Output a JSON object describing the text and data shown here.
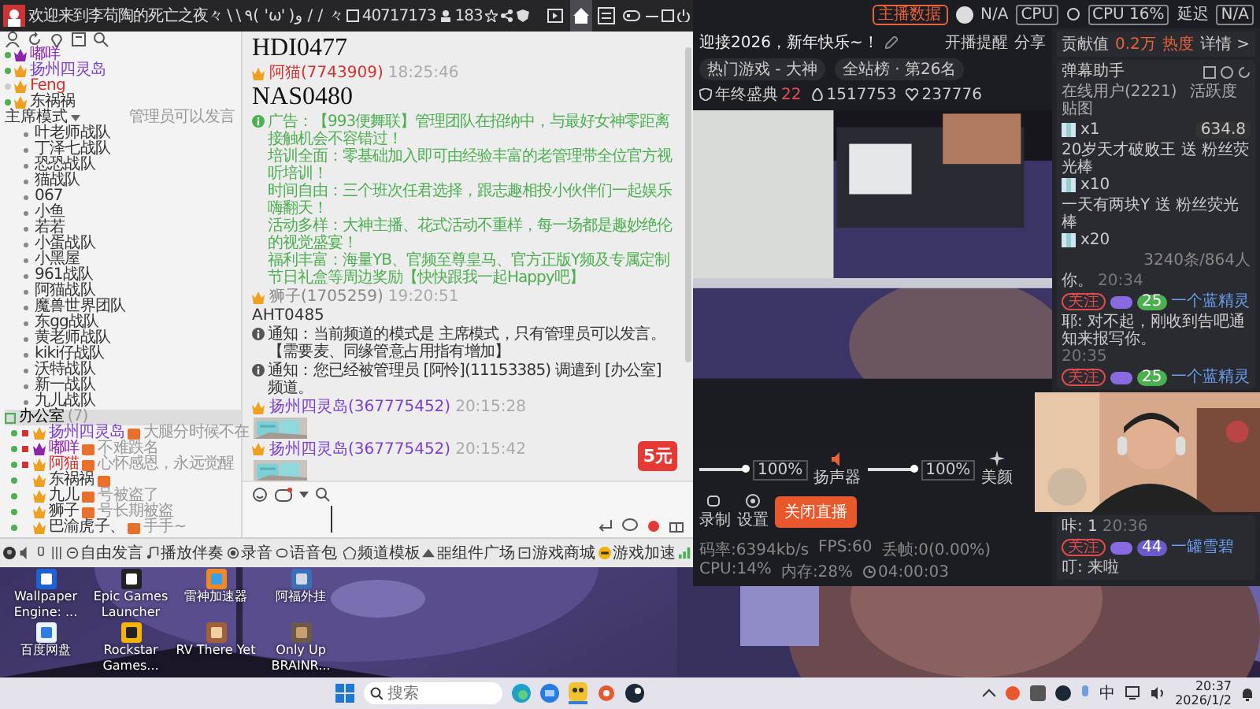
{
  "chat_window": {
    "title": "欢迎来到李苟陶的死亡之夜々 \\ \\ ٩( 'ω' )و / / 々",
    "channel_id": "40717173",
    "online_count": "183",
    "nav": [
      {
        "kind": "video",
        "selected": false
      },
      {
        "kind": "home",
        "selected": true
      },
      {
        "kind": "board",
        "selected": false
      },
      {
        "kind": "gamepad",
        "selected": false
      }
    ],
    "top_members": [
      {
        "name": "嘟咩",
        "color": "#8e24aa",
        "online": true
      },
      {
        "name": "扬州四灵岛",
        "color": "#7b3fd1",
        "online": true
      },
      {
        "name": "Feng",
        "color": "#d32f2f",
        "online": false
      },
      {
        "name": "东祸祸",
        "color": "#333333",
        "online": true
      }
    ],
    "mode": "主席模式",
    "mode_note": "管理员可以发言",
    "channels": [
      "叶老师战队",
      "丁泽七战队",
      "恐恐战队",
      "猫战队",
      "067",
      "小鱼",
      "若若",
      "小蛋战队",
      "小黑屋",
      "961战队",
      "阿猫战队",
      "魔兽世界团队",
      "东gg战队",
      "黄老师战队",
      "kiki仔战队",
      "沃特战队",
      "新一战队",
      "九儿战队"
    ],
    "office": {
      "name": "办公室",
      "count": "(7)"
    },
    "office_members": [
      {
        "name": "扬州四灵岛",
        "color": "#7b3fd1",
        "tagged": true,
        "status": "大腿分时候不在"
      },
      {
        "name": "嘟咩",
        "color": "#8e24aa",
        "tagged": true,
        "status": "不难跌名"
      },
      {
        "name": "阿猫",
        "color": "#d32f2f",
        "tagged": true,
        "status": "心怀感恩，永远觉醒"
      },
      {
        "name": "东祸祸",
        "color": "#333333",
        "tagged": false
      },
      {
        "name": "九儿",
        "color": "#333333",
        "tagged": false,
        "status": "号被盗了"
      },
      {
        "name": "狮子",
        "color": "#333333",
        "tagged": false,
        "status": "号长期被盗"
      },
      {
        "name": "巴渝虎子、",
        "color": "#333333",
        "tagged": false,
        "status": "手手~"
      }
    ],
    "messages": [
      {
        "kind": "code",
        "text": "HDI0477"
      },
      {
        "kind": "sender",
        "name": "阿猫(7743909)",
        "color": "#d32f2f",
        "time": "18:25:46"
      },
      {
        "kind": "code",
        "text": "NAS0480"
      },
      {
        "kind": "ad",
        "lines": [
          "广告：【993便舞联】管理团队在招纳中，与最好女神零距离接触机会不容错过！",
          "培训全面：零基础加入即可由经验丰富的老管理带全位官方视听培训！",
          "时间自由：三个班次任君选择，跟志趣相投小伙伴们一起娱乐嗨翻天！",
          "活动多样：大神主播、花式活动不重样，每一场都是趣妙绝伦的视觉盛宴！",
          "福利丰富：海量YB、官频至尊皇马、官方正版Y频及专属定制节日礼盒等周边奖励【快快跟我一起Happy吧】"
        ]
      },
      {
        "kind": "sender",
        "name": "狮子(1705259)",
        "color": "#888888",
        "time": "19:20:51"
      },
      {
        "kind": "text",
        "text": "AHT0485"
      },
      {
        "kind": "notice",
        "text": "通知：当前频道的模式是 主席模式，只有管理员可以发言。【需要麦、同缘管意占用指有增加】"
      },
      {
        "kind": "notice",
        "text": "通知：您已经被管理员 [阿怜](11153385) 调遣到 [办公室] 频道。"
      },
      {
        "kind": "sender",
        "name": "扬州四灵岛(367775452)",
        "color": "#7b3fd1",
        "time": "20:15:28"
      },
      {
        "kind": "picture"
      },
      {
        "kind": "sender",
        "name": "扬州四灵岛(367775452)",
        "color": "#7b3fd1",
        "time": "20:15:42"
      },
      {
        "kind": "picture"
      }
    ],
    "red_packet": "5元",
    "toolbar": [
      {
        "kind": "mic",
        "label": "自由发言"
      },
      {
        "kind": "music",
        "label": "播放伴奏"
      },
      {
        "kind": "record",
        "label": "录音"
      },
      {
        "kind": "voice",
        "label": "语音包"
      },
      {
        "kind": "template",
        "label": "频道模板"
      },
      {
        "kind": "widgets",
        "label": "组件广场"
      },
      {
        "kind": "shop",
        "label": "游戏商城"
      },
      {
        "kind": "boost",
        "label": "游戏加速"
      }
    ]
  },
  "stream_app": {
    "data_button": "主播数据",
    "avatar_text": "N/A",
    "gpu_label": "CPU",
    "cpu_label": "CPU 16%",
    "latency_label": "延迟",
    "latency_value": "N/A",
    "title": "迎接2026，新年快乐~！",
    "remind": "开播提醒",
    "share": "分享",
    "category": "热门游戏 - 大神",
    "rank": "全站榜 · 第26名",
    "event": "年终盛典",
    "event_value": "22",
    "views": "1517753",
    "likes": "237776",
    "mic": {
      "level": 1,
      "reading": "100%"
    },
    "speaker": {
      "label": "扬声器",
      "level": 1,
      "reading": "100%"
    },
    "tools": [
      {
        "kind": "beauty",
        "label": "美颜"
      },
      {
        "kind": "record",
        "label": "录制"
      },
      {
        "kind": "settings",
        "label": "设置"
      }
    ],
    "live_button": "关闭直播",
    "stats": [
      "码率:6394kb/s",
      "FPS:60",
      "丢帧:0(0.00%)",
      "CPU:14%",
      "内存:28%",
      "04:00:03"
    ],
    "panel": {
      "contribution_label": "贡献值",
      "contribution_value": "0.2万",
      "heat": "热度",
      "details": "详情 >",
      "title": "弹幕助手",
      "tabs": [
        "在线用户(2221)",
        "活跃度",
        "贴图"
      ],
      "feed": [
        {
          "kind": "gift",
          "text": "x1",
          "amount": "634.8"
        },
        {
          "kind": "line",
          "text": "20岁天才破败王 送 粉丝荧光棒",
          "suffix": "x10"
        },
        {
          "kind": "line",
          "text": "一天有两块Y 送 粉丝荧光棒",
          "suffix": "x20"
        },
        {
          "kind": "count",
          "text": "3240条/864人"
        },
        {
          "kind": "line",
          "text": "你。",
          "time": "20:34"
        },
        {
          "kind": "tags",
          "follow": "关注",
          "level": "25",
          "color": "#4caf50",
          "name": "一个蓝精灵"
        },
        {
          "kind": "line",
          "text": "耶: 对不起，刚收到告吧通知来报写你。",
          "time": "20:35"
        },
        {
          "kind": "tags",
          "follow": "关注",
          "level": "25",
          "color": "#4caf50",
          "name": "一个蓝精灵"
        }
      ],
      "feed_after": [
        {
          "kind": "line",
          "text": "咔: 1",
          "time": "20:36"
        },
        {
          "kind": "tags",
          "follow": "关注",
          "level": "44",
          "color": "#6a5acd",
          "name": "一罐雪碧"
        },
        {
          "kind": "line",
          "text": "叮: 来啦"
        }
      ]
    }
  },
  "desktop_icons": [
    {
      "kind": "wallpaper",
      "label": "Wallpaper Engine: ..."
    },
    {
      "kind": "epic",
      "label": "Epic Games Launcher"
    },
    {
      "kind": "thunder",
      "label": "雷神加速器"
    },
    {
      "kind": "tool",
      "label": "阿福外挂"
    },
    {
      "kind": "cloud",
      "label": "百度网盘"
    },
    {
      "kind": "rockstar",
      "label": "Rockstar Games..."
    },
    {
      "kind": "game",
      "label": "RV There Yet"
    },
    {
      "kind": "game2",
      "label": "Only Up BRAINR..."
    }
  ],
  "taskbar": {
    "search_placeholder": "搜索",
    "ime": "中",
    "time": "20:37",
    "date": "2026/1/2"
  }
}
